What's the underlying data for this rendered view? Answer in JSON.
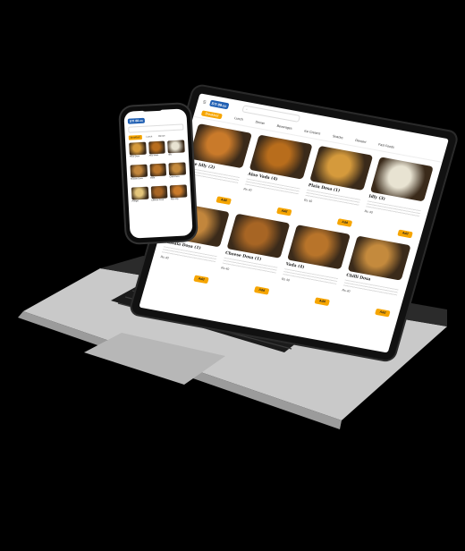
{
  "laptop": {
    "logo": "STI 88.cc",
    "search_placeholder": "",
    "categories": [
      "Breakfast",
      "Lunch",
      "Dinner",
      "Beverages",
      "Ice Creams",
      "Snacks",
      "Dessert",
      "Fast Foods"
    ],
    "items": [
      {
        "name": "Rice Idly (2)",
        "price": "Rs 40",
        "color": "#c97a2a"
      },
      {
        "name": "Aloo Vada (4)",
        "price": "Rs 40",
        "color": "#b86d1c"
      },
      {
        "name": "Plain Dosa (1)",
        "price": "Rs 40",
        "color": "#d59a3c"
      },
      {
        "name": "Idly (3)",
        "price": "Rs 40",
        "color": "#e8e3d2"
      },
      {
        "name": "Masala Dosa (1)",
        "price": "Rs 40",
        "color": "#c2863c"
      },
      {
        "name": "Cheese Dosa (1)",
        "price": "Rs 40",
        "color": "#a76524"
      },
      {
        "name": "Vada (4)",
        "price": "Rs 40",
        "color": "#b8742a"
      },
      {
        "name": "Chilli Dosa",
        "price": "Rs 40",
        "color": "#c48a3d"
      },
      {
        "name": "Pongal Sambar",
        "price": "Rs 40",
        "color": "#e4c57a"
      }
    ],
    "add_label": "Add"
  },
  "phone": {
    "logo": "STI 88.cc",
    "categories": [
      "Breakfast",
      "Lunch",
      "Dinner"
    ],
    "items": [
      {
        "label": "Plain Dosa",
        "color": "#d59a3c"
      },
      {
        "label": "Aloo Vada",
        "color": "#b86d1c"
      },
      {
        "label": "Idly",
        "color": "#e8e3d2"
      },
      {
        "label": "Masala Dosa",
        "color": "#c2863c"
      },
      {
        "label": "Vada",
        "color": "#b8742a"
      },
      {
        "label": "Chilli Dosa",
        "color": "#c48a3d"
      },
      {
        "label": "Pongal",
        "color": "#e4c57a"
      },
      {
        "label": "Cheese Dosa",
        "color": "#a76524"
      },
      {
        "label": "Rice Idly",
        "color": "#c97a2a"
      }
    ]
  },
  "colors": {
    "accent": "#f6a500",
    "brand": "#1f5fb3"
  }
}
